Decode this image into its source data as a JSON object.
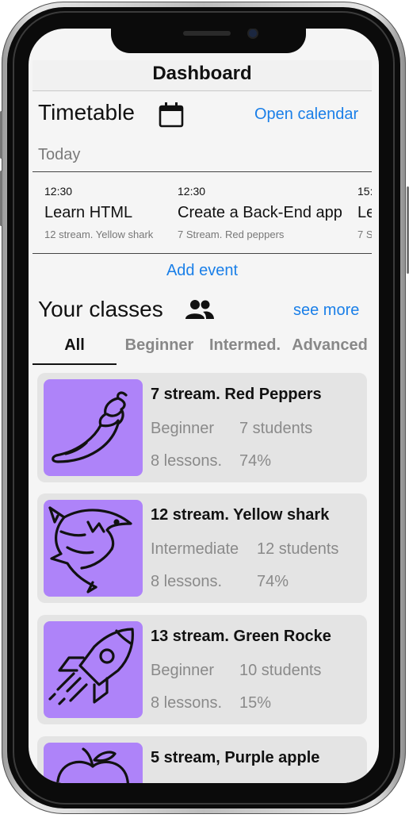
{
  "header": {
    "title": "Dashboard"
  },
  "timetable": {
    "title": "Timetable",
    "open_calendar": "Open calendar",
    "today_label": "Today",
    "events": [
      {
        "time": "12:30",
        "title": "Learn HTML",
        "subtitle": "12 stream. Yellow shark"
      },
      {
        "time": "12:30",
        "title": "Create a Back-End app",
        "subtitle": "7 Stream. Red peppers"
      },
      {
        "time": "15:",
        "title": "Le",
        "subtitle": "7 S"
      }
    ],
    "add_event": "Add event"
  },
  "classes": {
    "title": "Your classes",
    "see_more": "see more",
    "tabs": [
      "All",
      "Beginner",
      "Intermed.",
      "Advanced"
    ],
    "active_tab": "All",
    "items": [
      {
        "name": "7 stream. Red Peppers",
        "level": "Beginner",
        "students": "7 students",
        "lessons": "8 lessons.",
        "progress": "74%",
        "icon": "pepper-icon"
      },
      {
        "name": "12 stream. Yellow shark",
        "level": "Intermediate",
        "students": "12 students",
        "lessons": "8 lessons.",
        "progress": "74%",
        "icon": "shark-icon"
      },
      {
        "name": "13 stream. Green Rocket",
        "level": "Beginner",
        "students": "10 students",
        "lessons": "8 lessons.",
        "progress": "15%",
        "icon": "rocket-icon"
      },
      {
        "name": "5 stream, Purple apple",
        "icon": "apple-icon"
      }
    ]
  },
  "colors": {
    "accent": "#1a7fe8",
    "thumb": "#ae83f9",
    "card": "#e4e4e4"
  }
}
